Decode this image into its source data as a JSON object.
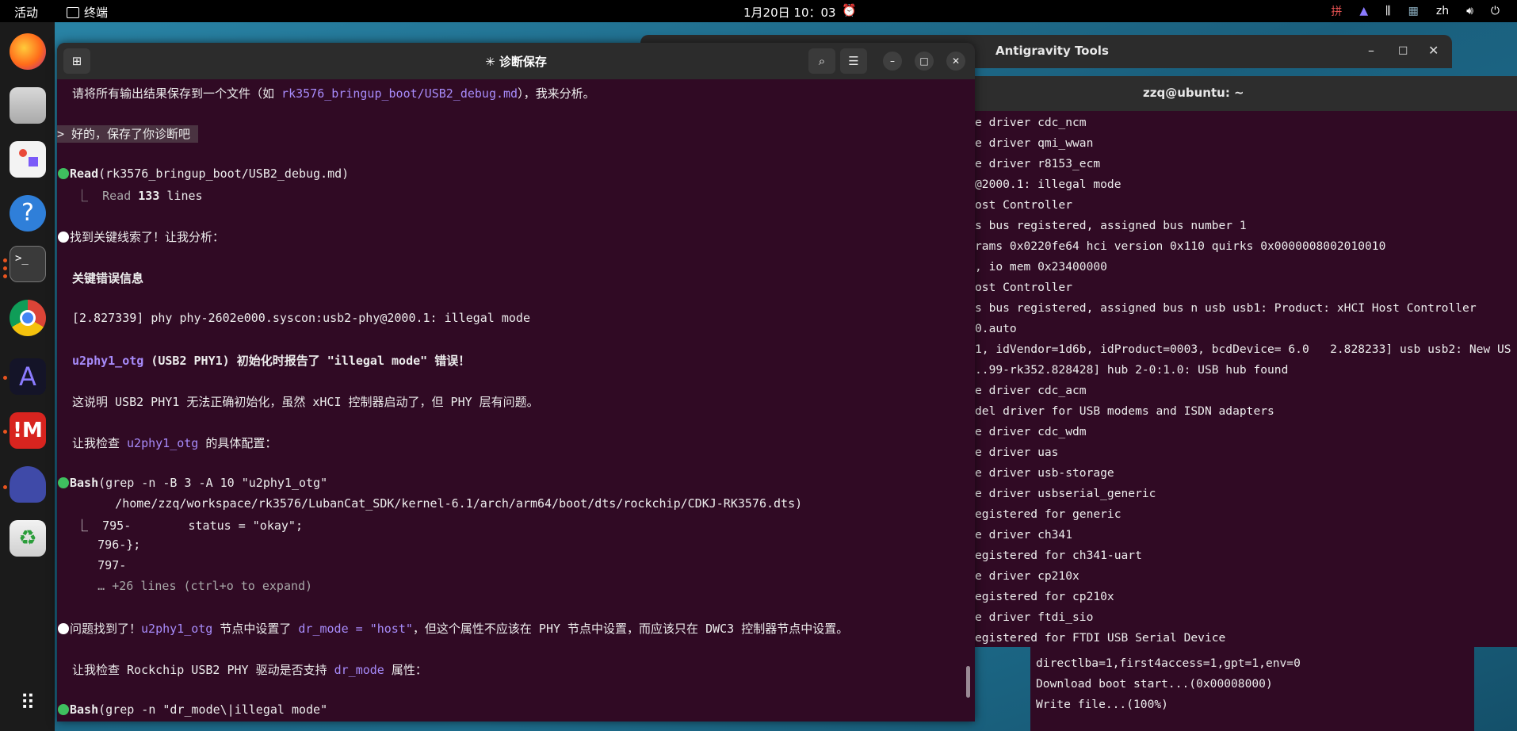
{
  "topbar": {
    "activities": "活动",
    "app_name": "终端",
    "clock": "1月20日 10：03",
    "tray_lang": "zh"
  },
  "dock": {
    "items": [
      "firefox-icon",
      "files-icon",
      "app-store-icon",
      "help-icon",
      "terminal-icon",
      "chrome-icon",
      "antigravity-icon",
      "app-red-icon",
      "cat-app-icon",
      "trash-icon",
      "app-grid-icon"
    ]
  },
  "bg_window": {
    "title": "Antigravity Tools"
  },
  "bg_terminal": {
    "title": "zzq@ubuntu: ~",
    "lines": [
      "e driver cdc_ncm",
      "e driver qmi_wwan",
      "e driver r8153_ecm",
      "@2000.1: illegal mode",
      "ost Controller",
      "s bus registered, assigned bus number 1",
      "rams 0x0220fe64 hci version 0x110 quirks 0x0000008002010010",
      ", io mem 0x23400000",
      "ost Controller",
      "s bus registered, assigned bus n usb usb1: Product: xHCI Host Controller",
      "0.auto",
      "1, idVendor=1d6b, idProduct=0003, bcdDevice= 6.0   2.828233] usb usb2: New US",
      "..99-rk352.828428] hub 2-0:1.0: USB hub found",
      "e driver cdc_acm",
      "del driver for USB modems and ISDN adapters",
      "e driver cdc_wdm",
      "e driver uas",
      "e driver usb-storage",
      "e driver usbserial_generic",
      "egistered for generic",
      "e driver ch341",
      "egistered for ch341-uart",
      "e driver cp210x",
      "egistered for cp210x",
      "e driver ftdi_sio",
      "egistered for FTDI USB Serial Device"
    ]
  },
  "bg_terminal2": {
    "lines": [
      "directlba=1,first4access=1,gpt=1,env=0",
      "Download boot start...(0x00008000)",
      "Write file...(100%)"
    ]
  },
  "main": {
    "title": "✳ 诊断保存",
    "line_intro_a": "请将所有输出结果保存到一个文件（如 ",
    "line_intro_path": "rk3576_bringup_boot/USB2_debug.md",
    "line_intro_b": "），我来分析。",
    "prompt": "> 好的，保存了你诊断吧",
    "read_tool": "Read",
    "read_arg": "(rk3576_bringup_boot/USB2_debug.md)",
    "read_result_a": "  ⎿  Read ",
    "read_result_num": "133",
    "read_result_b": " lines",
    "found": "找到关键线索了！让我分析：",
    "heading": "关键错误信息",
    "err_line": "[2.827339] phy phy-2602e000.syscon:usb2-phy@2000.1: illegal mode",
    "u2_name": "u2phy1_otg",
    "u2_rest": " (USB2 PHY1) 初始化时报告了 \"illegal mode\" 错误！",
    "explain": "这说明 USB2 PHY1 无法正确初始化，虽然 xHCI 控制器启动了，但 PHY 层有问题。",
    "check_a": "让我检查 ",
    "check_name": "u2phy1_otg",
    "check_b": " 的具体配置：",
    "bash_tool": "Bash",
    "bash_arg1": "(grep -n -B 3 -A 10 \"u2phy1_otg\"",
    "bash_arg2": "      /home/zzq/workspace/rk3576/LubanCat_SDK/kernel-6.1/arch/arm64/boot/dts/rockchip/CDKJ-RK3576.dts)",
    "out1": "  ⎿  795-        status = \"okay\";",
    "out2": "     796-};",
    "out3": "     797-",
    "out4": "     … +26 lines (ctrl+o to expand)",
    "problem_a": "问题找到了！",
    "problem_name": "u2phy1_otg",
    "problem_b": " 节点中设置了 ",
    "problem_code": "dr_mode = \"host\"",
    "problem_c": "，但这个属性不应该在 PHY 节点中设置，而应该只在 DWC3 控制器节点中设置。",
    "check2_a": "让我检查 Rockchip USB2 PHY 驱动是否支持 ",
    "check2_code": "dr_mode",
    "check2_b": " 属性：",
    "bash2_tool": "Bash",
    "bash2_arg": "(grep -n \"dr_mode\\|illegal mode\""
  }
}
